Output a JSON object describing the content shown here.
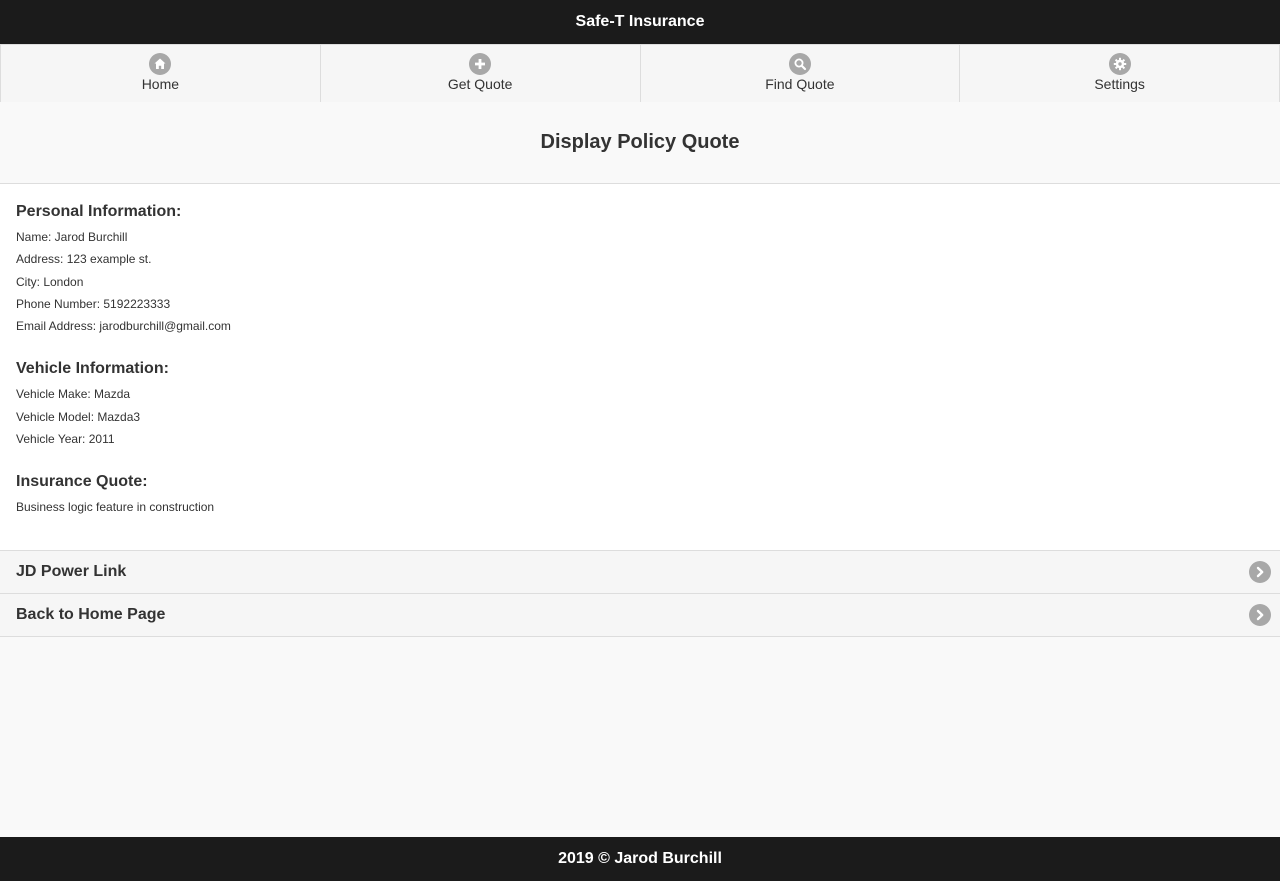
{
  "header": {
    "title": "Safe-T Insurance"
  },
  "nav": [
    {
      "label": "Home",
      "icon": "home-icon"
    },
    {
      "label": "Get Quote",
      "icon": "plus-icon"
    },
    {
      "label": "Find Quote",
      "icon": "search-icon"
    },
    {
      "label": "Settings",
      "icon": "gear-icon"
    }
  ],
  "page": {
    "title": "Display Policy Quote"
  },
  "personal": {
    "title": "Personal Information:",
    "name": "Name: Jarod Burchill",
    "address": "Address: 123 example st.",
    "city": "City: London",
    "phone": "Phone Number: 5192223333",
    "email": "Email Address: jarodburchill@gmail.com"
  },
  "vehicle": {
    "title": "Vehicle Information:",
    "make": "Vehicle Make: Mazda",
    "model": "Vehicle Model: Mazda3",
    "year": "Vehicle Year: 2011"
  },
  "quote": {
    "title": "Insurance Quote:",
    "text": "Business logic feature in construction"
  },
  "links": [
    {
      "label": "JD Power Link",
      "icon": "chevron-right-icon"
    },
    {
      "label": "Back to Home Page",
      "icon": "chevron-right-icon"
    }
  ],
  "footer": {
    "text": "2019 © Jarod Burchill"
  },
  "colors": {
    "bar": "#1b1b1b",
    "icon_bg": "#a8a8a8",
    "border": "#dddddd"
  }
}
